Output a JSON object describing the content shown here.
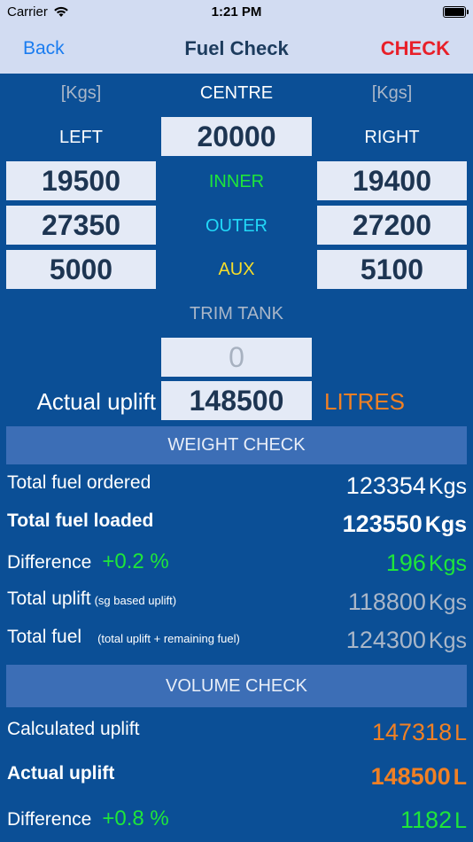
{
  "status": {
    "carrier": "Carrier",
    "time": "1:21 PM"
  },
  "nav": {
    "back": "Back",
    "title": "Fuel Check",
    "check": "CHECK"
  },
  "tanks": {
    "unit_left": "[Kgs]",
    "unit_right": "[Kgs]",
    "centre_label": "CENTRE",
    "centre_value": "20000",
    "left_label": "LEFT",
    "right_label": "RIGHT",
    "inner_label": "INNER",
    "outer_label": "OUTER",
    "aux_label": "AUX",
    "left_inner": "19500",
    "right_inner": "19400",
    "left_outer": "27350",
    "right_outer": "27200",
    "left_aux": "5000",
    "right_aux": "5100",
    "trim_label": "TRIM TANK",
    "trim_value": "0",
    "uplift_label": "Actual uplift",
    "uplift_value": "148500",
    "uplift_unit": "LITRES"
  },
  "weight_check": {
    "header": "WEIGHT CHECK",
    "ordered_label": "Total fuel ordered",
    "ordered_value": "123354",
    "loaded_label": "Total fuel loaded",
    "loaded_value": "123550",
    "diff_label": "Difference",
    "diff_percent": "+0.2 %",
    "diff_value": "196",
    "uplift_label": "Total uplift",
    "uplift_note": "(sg based uplift)",
    "uplift_value": "118800",
    "fuel_label": "Total fuel",
    "fuel_note": "(total uplift + remaining fuel)",
    "fuel_value": "124300",
    "unit": "Kgs"
  },
  "volume_check": {
    "header": "VOLUME CHECK",
    "calc_label": "Calculated uplift",
    "calc_value": "147318",
    "actual_label": "Actual uplift",
    "actual_value": "148500",
    "diff_label": "Difference",
    "diff_percent": "+0.8 %",
    "diff_value": "1182",
    "unit": "L"
  },
  "colors": {
    "background": "#0b4f96",
    "nav_background": "#d2dcf2",
    "accent_blue": "#1a7cf0",
    "check_red": "#e8202a",
    "green": "#1ee63a",
    "cyan": "#22d8f8",
    "yellow": "#f6dd2a",
    "orange": "#f08024"
  }
}
